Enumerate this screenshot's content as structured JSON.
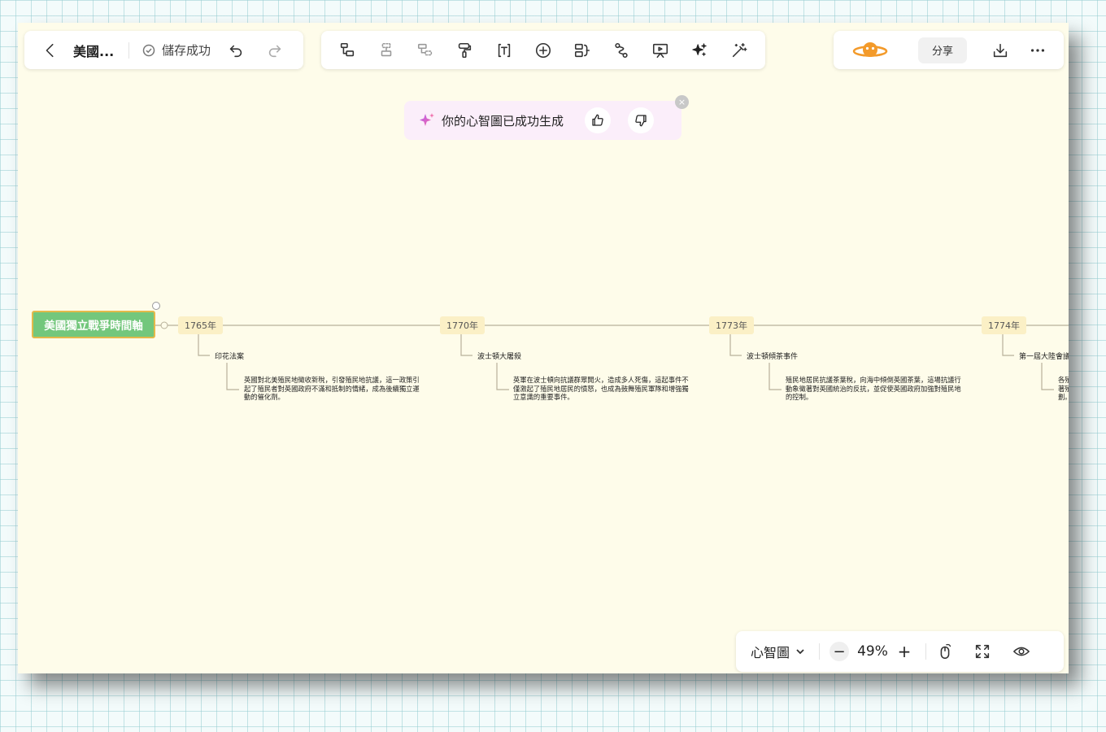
{
  "header": {
    "back_icon": "chevron-left-icon",
    "doc_title": "美國...",
    "save_status": "儲存成功",
    "undo_icon": "undo-icon",
    "redo_icon": "redo-icon"
  },
  "toolbar": {
    "tools": [
      {
        "name": "add-child-node-icon"
      },
      {
        "name": "add-sibling-node-icon"
      },
      {
        "name": "add-parent-node-icon"
      },
      {
        "name": "format-painter-icon"
      },
      {
        "name": "text-box-icon"
      },
      {
        "name": "insert-plus-icon"
      },
      {
        "name": "summary-icon"
      },
      {
        "name": "relationship-icon"
      },
      {
        "name": "presentation-icon"
      },
      {
        "name": "ai-sparkle-icon"
      },
      {
        "name": "magic-wand-icon"
      }
    ]
  },
  "right_panel": {
    "brand_logo": "planet-logo",
    "brand_color": "#f39a2a",
    "share_label": "分享",
    "download_icon": "download-icon",
    "more_icon": "more-dots-icon"
  },
  "toast": {
    "message": "你的心智圖已成功生成",
    "like_icon": "thumbs-up-icon",
    "dislike_icon": "thumbs-down-icon",
    "close_label": "×"
  },
  "mindmap": {
    "root": "美國獨立戰爭時間軸",
    "root_color": "#73c77c",
    "nodes": [
      {
        "year": "1765年",
        "event": "印花法案",
        "description": "英國對北美殖民地徵收新稅，引發殖民地抗議，這一政策引起了殖民者對英國政府不滿和抵制的情緒，成為後續獨立運動的催化劑。"
      },
      {
        "year": "1770年",
        "event": "波士頓大屠殺",
        "description": "英軍在波士頓向抗議群眾開火，造成多人死傷，這起事件不僅激起了殖民地居民的憤怒，也成為鼓舞殖民軍隊和增強獨立意識的重要事件。"
      },
      {
        "year": "1773年",
        "event": "波士頓傾茶事件",
        "description": "殖民地居民抗議茶葉稅，向海中傾倒英國茶葉，這場抗議行動象徵著對英國統治的反抗，並促使英國政府加強對殖民地的控制。"
      },
      {
        "year": "1774年",
        "event": "第一屆大陸會議",
        "description": "各殖\n著殖\n劃。"
      }
    ]
  },
  "zoom_panel": {
    "layout_label": "心智圖",
    "zoom_out_label": "−",
    "zoom_level": "49%",
    "zoom_in_label": "+",
    "mouse_icon": "mouse-icon",
    "fit_icon": "fit-screen-icon",
    "preview_icon": "eye-icon"
  }
}
